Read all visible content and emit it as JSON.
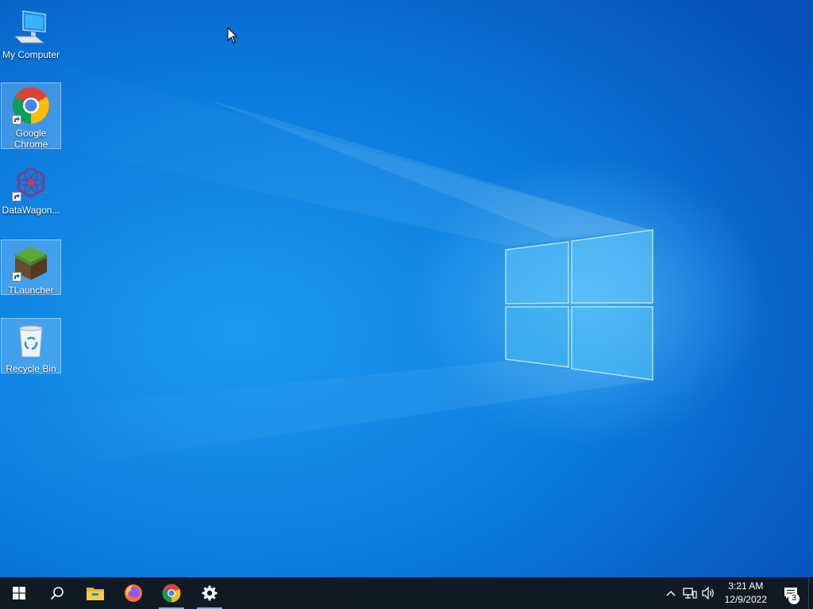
{
  "desktop": {
    "icons": [
      {
        "label": "My Computer"
      },
      {
        "label": "Google Chrome"
      },
      {
        "label": "DataWagon..."
      },
      {
        "label": "TLauncher"
      },
      {
        "label": "Recycle Bin"
      }
    ]
  },
  "taskbar": {
    "pinned": [
      "start-icon",
      "search-icon",
      "file-explorer-icon",
      "firefox-icon",
      "chrome-icon",
      "settings-icon"
    ],
    "clock": {
      "time": "3:21 AM",
      "date": "12/9/2022"
    },
    "notifications": {
      "count": "3"
    }
  },
  "colors": {
    "taskbar": "#0f1a24",
    "accent": "#76b9ed",
    "wallpaper": "#0b78dc"
  }
}
